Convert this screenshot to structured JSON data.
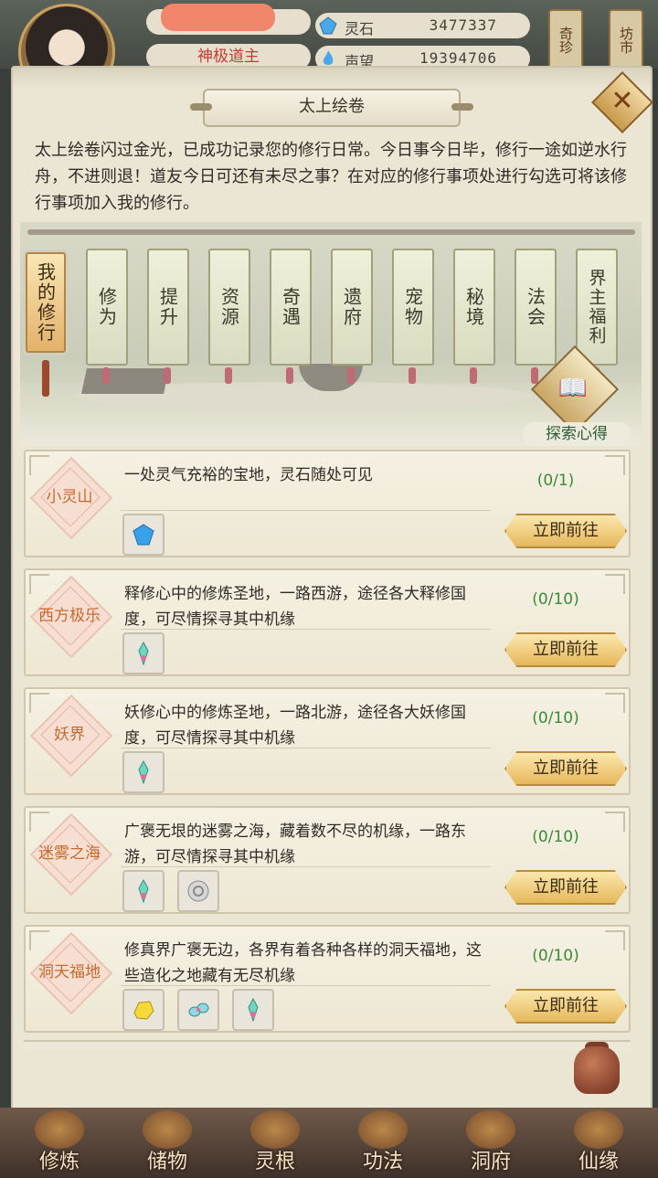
{
  "header": {
    "title_badge": "神极道主",
    "resources": [
      {
        "icon": "spirit-stone-icon",
        "label": "灵石",
        "value": "3477337"
      },
      {
        "icon": "reputation-flame-icon",
        "label": "声望",
        "value": "19394706"
      }
    ],
    "side_buttons": [
      "奇珍",
      "坊市"
    ]
  },
  "panel": {
    "title": "太上绘卷",
    "intro": "太上绘卷闪过金光，已成功记录您的修行日常。今日事今日毕，修行一途如逆水行舟，不进则退！道友今日可还有未尽之事？在对应的修行事项处进行勾选可将该修行事项加入我的修行。",
    "tabs": [
      "我的修行",
      "修为",
      "提升",
      "资源",
      "奇遇",
      "遗府",
      "宠物",
      "秘境",
      "法会",
      "界主福利"
    ],
    "explore_label": "探索心得"
  },
  "cards": [
    {
      "name": "小灵山",
      "desc": "一处灵气充裕的宝地，灵石随处可见",
      "progress": "(0/1)",
      "button": "立即前往",
      "rewards": [
        "spirit-stone-icon"
      ]
    },
    {
      "name": "西方极乐",
      "desc": "释修心中的修炼圣地，一路西游，途径各大释修国度，可尽情探寻其中机缘",
      "progress": "(0/10)",
      "button": "立即前往",
      "rewards": [
        "jade-crystal-icon"
      ]
    },
    {
      "name": "妖界",
      "desc": "妖修心中的修炼圣地，一路北游，途径各大妖修国度，可尽情探寻其中机缘",
      "progress": "(0/10)",
      "button": "立即前往",
      "rewards": [
        "jade-crystal-icon"
      ]
    },
    {
      "name": "迷雾之海",
      "desc": "广褒无垠的迷雾之海，藏着数不尽的机缘，一路东游，可尽情探寻其中机缘",
      "progress": "(0/10)",
      "button": "立即前往",
      "rewards": [
        "jade-crystal-icon",
        "silver-coin-icon"
      ]
    },
    {
      "name": "洞天福地",
      "desc": "修真界广褒无边，各界有着各种各样的洞天福地，这些造化之地藏有无尽机缘",
      "progress": "(0/10)",
      "button": "立即前往",
      "rewards": [
        "gold-nugget-icon",
        "jade-pendant-icon",
        "jade-crystal-icon"
      ]
    }
  ],
  "nav": [
    "修炼",
    "储物",
    "灵根",
    "功法",
    "洞府",
    "仙缘"
  ],
  "colors": {
    "accent_gold": "#e6b85c",
    "progress_green": "#3a8a3a",
    "place_name": "#c56a2d"
  }
}
